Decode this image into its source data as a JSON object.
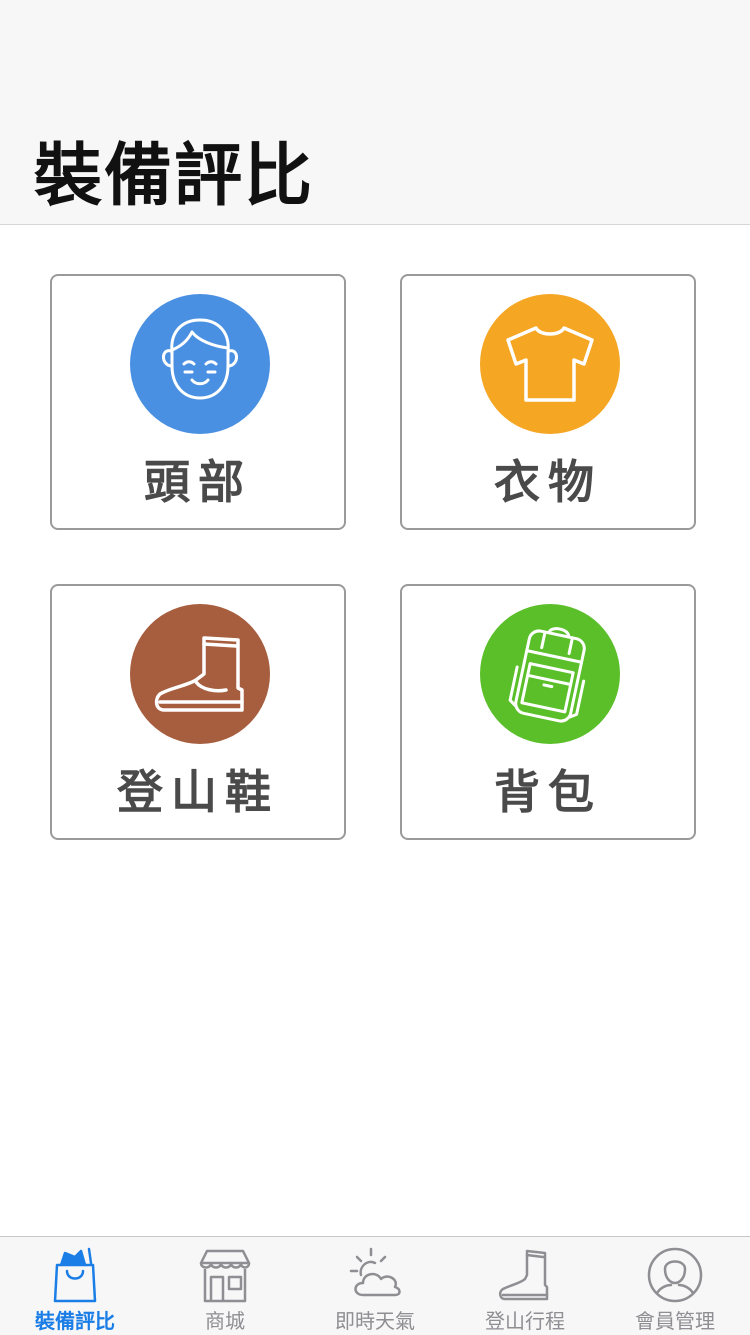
{
  "header": {
    "title": "裝備評比"
  },
  "categories": [
    {
      "label": "頭部",
      "icon": "face-icon",
      "color": "#4a90e2"
    },
    {
      "label": "衣物",
      "icon": "tshirt-icon",
      "color": "#f5a623"
    },
    {
      "label": "登山鞋",
      "icon": "boot-icon",
      "color": "#a65e3f"
    },
    {
      "label": "背包",
      "icon": "backpack-icon",
      "color": "#5bbf2a"
    }
  ],
  "tabbar": {
    "active_color": "#1a7ee6",
    "items": [
      {
        "label": "裝備評比",
        "icon": "shopping-bag-icon",
        "active": true
      },
      {
        "label": "商城",
        "icon": "storefront-icon",
        "active": false
      },
      {
        "label": "即時天氣",
        "icon": "sun-cloud-icon",
        "active": false
      },
      {
        "label": "登山行程",
        "icon": "boot-icon",
        "active": false
      },
      {
        "label": "會員管理",
        "icon": "user-circle-icon",
        "active": false
      }
    ]
  }
}
